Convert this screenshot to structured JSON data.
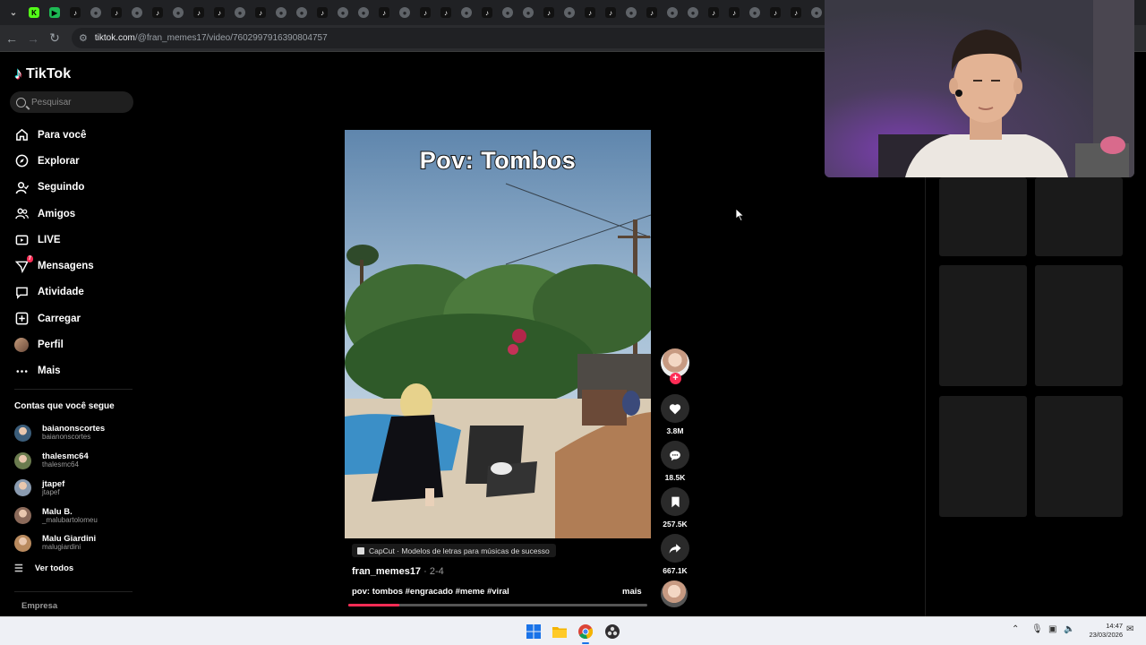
{
  "browser": {
    "url_host": "tiktok.com",
    "url_path": "/@fran_memes17/video/7602997916390804757",
    "tab_icons": [
      "down",
      "kick",
      "green",
      "tiktok",
      "gray",
      "tiktok",
      "gray",
      "tiktok",
      "gray",
      "tiktok",
      "tiktok",
      "gray",
      "tiktok",
      "gray",
      "gray",
      "tiktok",
      "gray",
      "gray",
      "tiktok",
      "gray",
      "tiktok",
      "tiktok",
      "gray",
      "tiktok",
      "gray",
      "gray",
      "tiktok",
      "gray",
      "tiktok",
      "tiktok",
      "gray",
      "tiktok",
      "gray",
      "gray",
      "tiktok",
      "tiktok",
      "gray",
      "tiktok",
      "tiktok",
      "gray",
      "tiktok"
    ]
  },
  "sidebar": {
    "logo": "TikTok",
    "search_placeholder": "Pesquisar",
    "menu": [
      {
        "label": "Para você",
        "icon": "home-icon"
      },
      {
        "label": "Explorar",
        "icon": "compass-icon"
      },
      {
        "label": "Seguindo",
        "icon": "user-check-icon"
      },
      {
        "label": "Amigos",
        "icon": "friends-icon"
      },
      {
        "label": "LIVE",
        "icon": "live-tv-icon"
      },
      {
        "label": "Mensagens",
        "icon": "messages-icon",
        "badge": "7"
      },
      {
        "label": "Atividade",
        "icon": "activity-icon"
      },
      {
        "label": "Carregar",
        "icon": "upload-icon"
      },
      {
        "label": "Perfil",
        "icon": "profile-avatar-icon"
      },
      {
        "label": "Mais",
        "icon": "more-dots-icon"
      }
    ],
    "following_title": "Contas que você segue",
    "following": [
      {
        "name": "baianonscortes",
        "handle": "baianonscortes",
        "color": "#3b5d7a"
      },
      {
        "name": "thalesmc64",
        "handle": "thalesmc64",
        "color": "#6a7b4e"
      },
      {
        "name": "jtapef",
        "handle": "jtapef",
        "color": "#8a9bb0"
      },
      {
        "name": "Malu B.",
        "handle": "_malubartolomeu",
        "color": "#8b6a5a"
      },
      {
        "name": "Malu Giardini",
        "handle": "malugiardini",
        "color": "#b98a5e"
      }
    ],
    "see_all": "Ver todos",
    "empresa": "Empresa"
  },
  "video": {
    "overlay_title": "Pov: Tombos",
    "capcut_label": "CapCut · Modelos de letras para músicas de sucesso",
    "author": "fran_memes17",
    "date": " · 2-4",
    "caption": "pov: tombos #engracado #meme #viral",
    "more": "mais",
    "progress": 0.17
  },
  "actions": {
    "likes": "3.8M",
    "comments": "18.5K",
    "saves": "257.5K",
    "shares": "667.1K"
  },
  "taskbar": {
    "time": "14:47",
    "date": "23/03/2026"
  },
  "colors": {
    "accent": "#fe2c55",
    "background": "#000000"
  }
}
